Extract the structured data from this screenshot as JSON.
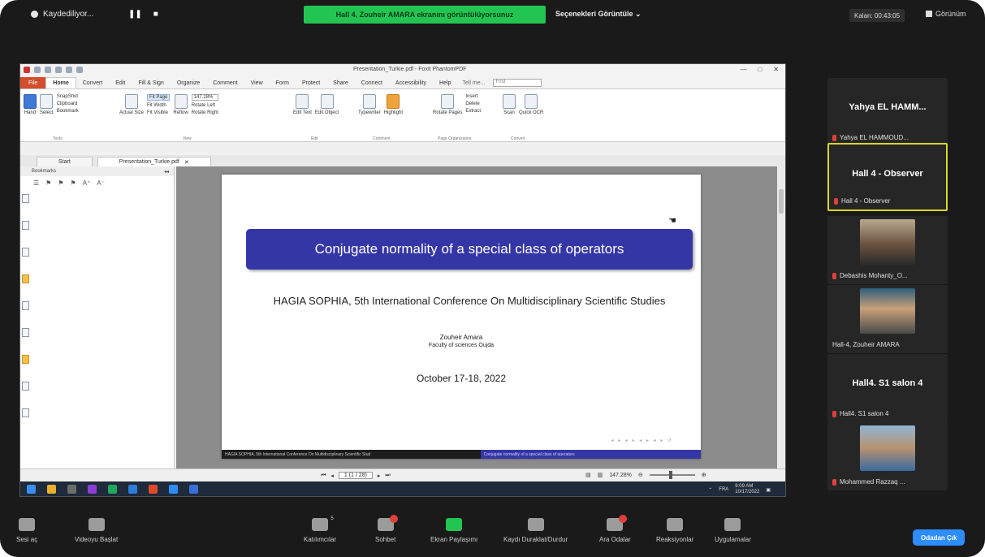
{
  "zoom": {
    "recording_status": "Kaydediliyor...",
    "pause_glyph": "❚❚",
    "stop_glyph": "■",
    "share_banner": "Hall 4, Zouheir AMARA ekranını görüntülüyorsunuz",
    "view_options": "Seçenekleri Görüntüle ⌄",
    "exit_fullscreen": "Kalan: 00:43:05",
    "view_label": "Görünüm"
  },
  "foxit": {
    "window_title": "Presentation_Turkie.pdf - Foxit PhantomPDF",
    "menu_file": "File",
    "menu_tabs": [
      "Home",
      "Convert",
      "Edit",
      "Fill & Sign",
      "Organize",
      "Comment",
      "View",
      "Form",
      "Protect",
      "Share",
      "Connect",
      "Accessibility",
      "Help"
    ],
    "tell_me": "Tell me...",
    "find_placeholder": "Find",
    "ribbon": {
      "hand": "Hand",
      "select": "Select",
      "snapshot": "SnapShot",
      "clipboard": "Clipboard",
      "bookmark": "Bookmark",
      "actual_size": "Actual Size",
      "fit_page": "Fit Page",
      "fit_width": "Fit Width",
      "fit_visible": "Fit Visible",
      "reflow": "Reflow",
      "zoom_value": "147.28%",
      "rotate_left": "Rotate Left",
      "rotate_right": "Rotate Right",
      "edit_text": "Edit Text",
      "edit_object": "Edit Object",
      "typewriter": "Typewriter",
      "highlight": "Highlight",
      "rotate_pages": "Rotate Pages",
      "insert": "Insert",
      "delete": "Delete",
      "extract": "Extract",
      "scan": "Scan",
      "quick_ocr": "Quick OCR",
      "group_tools": "Tools",
      "group_view": "View",
      "group_edit": "Edit",
      "group_comment": "Comment",
      "group_page_org": "Page Organization",
      "group_convert": "Convert"
    },
    "doc_tabs": [
      "Start",
      "Presentation_Turkie.pdf"
    ],
    "bookmarks_title": "Bookmarks",
    "slide": {
      "title": "Conjugate normality of a special class of operators",
      "conference": "HAGIA SOPHIA, 5th International Conference On Multidisciplinary Scientific Studies",
      "author": "Zouheir Amara",
      "affiliation": "Faculty of sciences Oujda",
      "date": "October 17-18, 2022",
      "footer_left": "HAGIA SOPHIA, 5th International Conference On Multidisciplinary Scientific Stud",
      "footer_right": "Conjugate normality of a special class of operators"
    },
    "status": {
      "page_field": "1 (1 / 28)",
      "zoom": "147.28%"
    },
    "taskbar": {
      "time": "9:09 AM",
      "date": "10/17/2022",
      "lang": "FRA"
    }
  },
  "participants": [
    {
      "big_name": "Yahya EL HAMM...",
      "label": "Yahya EL HAMMOUD..."
    },
    {
      "big_name": "Hall 4 - Observer",
      "label": "Hall 4 - Observer"
    },
    {
      "label": "Debashis Mohanty_O..."
    },
    {
      "label": "Hall-4, Zouheir AMARA"
    },
    {
      "big_name": "Hall4. S1 salon 4",
      "label": "Hall4. S1 salon 4"
    },
    {
      "label": "Mohammed Razzaq ..."
    }
  ],
  "toolbar": {
    "mute": "Sesi aç",
    "video": "Videoyu Başlat",
    "participants": "Katılımcılar",
    "participants_count": "5",
    "chat": "Sohbet",
    "share": "Ekran Paylaşımı",
    "record": "Kaydı Duraklat/Durdur",
    "breakout": "Ara Odalar",
    "reactions": "Reaksiyonlar",
    "apps": "Uygulamalar",
    "leave": "Odadan Çık"
  }
}
